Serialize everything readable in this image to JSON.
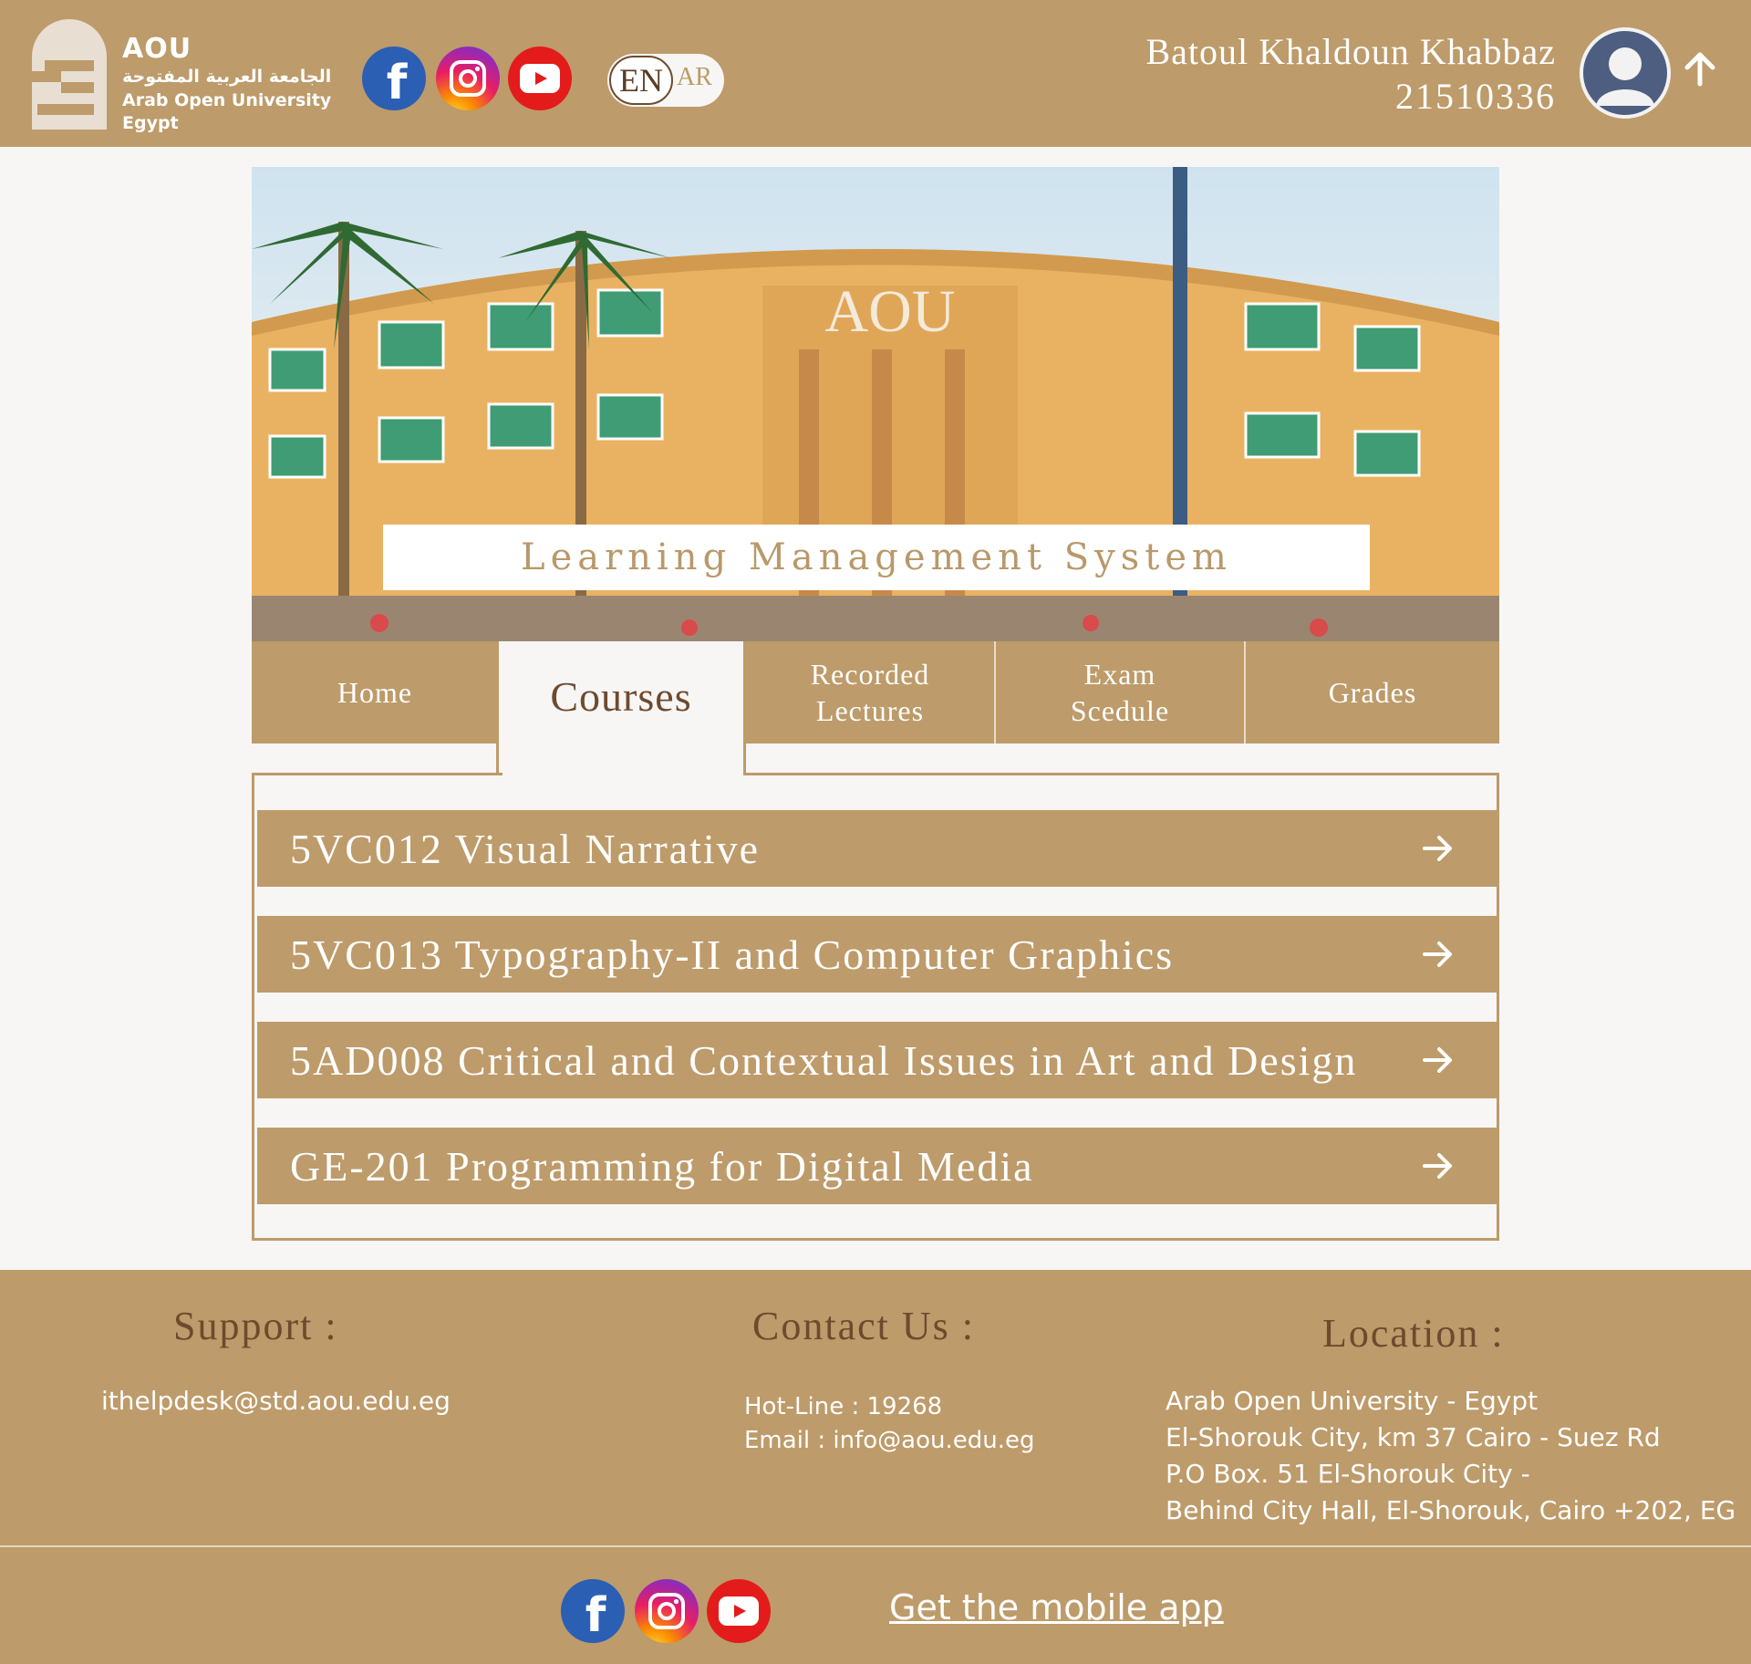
{
  "header": {
    "logo": {
      "name": "AOU",
      "arabic_name": "الجامعة العربية المفتوحة",
      "english_name": "Arab Open University",
      "country": "Egypt"
    },
    "social": [
      "facebook-icon",
      "instagram-icon",
      "youtube-icon"
    ],
    "language": {
      "active": "EN",
      "inactive": "AR"
    },
    "user": {
      "name": "Batoul Khaldoun Khabbaz",
      "id": "21510336"
    }
  },
  "banner": {
    "sign": "AOU",
    "title": "Learning Management System"
  },
  "nav": {
    "tabs": [
      {
        "label": "Home"
      },
      {
        "label": "Courses"
      },
      {
        "label": "Recorded\nLectures"
      },
      {
        "label": "Exam\nScedule"
      },
      {
        "label": "Grades"
      }
    ],
    "active": "Courses"
  },
  "courses": [
    {
      "label": "5VC012 Visual Narrative"
    },
    {
      "label": "5VC013 Typography-II and Computer Graphics"
    },
    {
      "label": "5AD008 Critical and Contextual Issues in Art and Design"
    },
    {
      "label": "GE-201 Programming for Digital Media"
    }
  ],
  "footer": {
    "support": {
      "title": "Support :",
      "email": "ithelpdesk@std.aou.edu.eg"
    },
    "contact": {
      "title": "Contact Us :",
      "hotline": "Hot-Line : 19268",
      "email": "Email : info@aou.edu.eg"
    },
    "location": {
      "title": "Location :",
      "lines": [
        "Arab Open University - Egypt",
        "El-Shorouk City, km 37 Cairo - Suez Rd",
        "P.O Box. 51 El-Shorouk City -",
        "Behind City Hall, El-Shorouk, Cairo +202, EG"
      ]
    },
    "mobile_app": "Get the mobile app"
  },
  "colors": {
    "primary": "#bd9b6a",
    "background": "#f7f6f4",
    "dark_brown": "#6e4a2e",
    "text_light": "#ffffff"
  }
}
